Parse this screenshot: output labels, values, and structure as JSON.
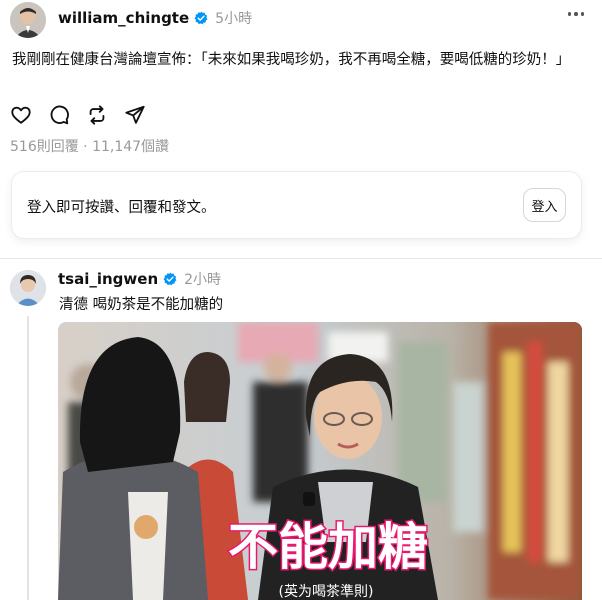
{
  "post": {
    "username": "william_chingte",
    "time": "5小時",
    "text": "我剛剛在健康台灣論壇宣佈：「未來如果我喝珍奶，我不再喝全糖，要喝低糖的珍奶！」",
    "stats": "516則回覆 · 11,147個讚"
  },
  "login_card": {
    "prompt": "登入即可按讚、回覆和發文。",
    "button": "登入"
  },
  "reply": {
    "username": "tsai_ingwen",
    "time": "2小時",
    "text": "清德 喝奶茶是不能加糖的",
    "video_caption_main": "不能加糖",
    "video_caption_sub": "(英为喝茶準則)"
  },
  "colors": {
    "verified": "#0095f6",
    "muted": "#999999",
    "caption_pink": "#e8196f"
  }
}
